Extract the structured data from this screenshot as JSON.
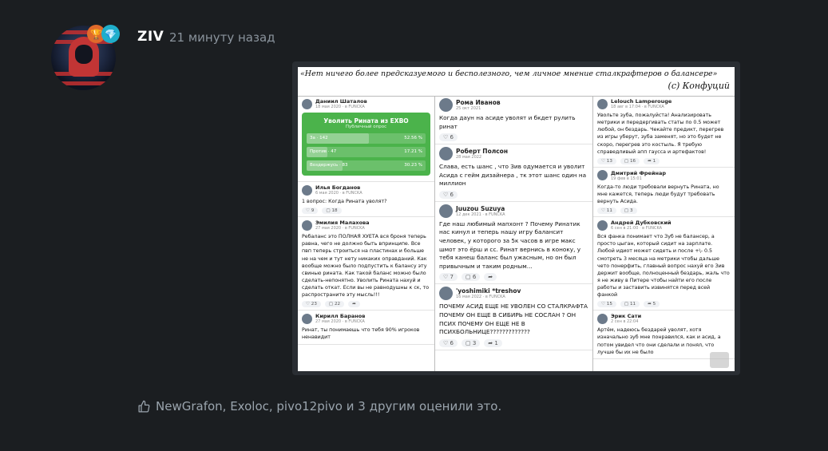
{
  "post": {
    "username": "ZIV",
    "timestamp": "21 минуту назад",
    "badges": [
      "trophy-icon",
      "gem-icon"
    ]
  },
  "image": {
    "quote_line": "«Нет ничего более предсказуемого и бесполезного, чем личное мнение сталкрафтеров о балансере»",
    "quote_author": "(с) Конфуций",
    "col1": {
      "post1": {
        "name": "Даниил Шаталов",
        "date": "18 мая 2020 · в FUNCKA"
      },
      "poll": {
        "title": "Уволить Рината из EXBO",
        "subtitle": "Публичный опрос",
        "options": [
          {
            "label": "За",
            "count": "142",
            "percent": "52.56 %",
            "share": 0.5256
          },
          {
            "label": "Против",
            "count": "47",
            "percent": "17.21 %",
            "share": 0.1721
          },
          {
            "label": "Воздержусь",
            "count": "83",
            "percent": "30.23 %",
            "share": 0.3023
          }
        ]
      },
      "post2": {
        "name": "Илья Богданов",
        "date": "6 мая 2020 · в FUNCKA",
        "text": "1 вопрос: Когда Рината уволят?",
        "likes": "9",
        "comments": "18"
      },
      "post3": {
        "name": "Эмилия Малахова",
        "date": "27 мая 2020 · в FUNCKA",
        "text": "Ребаланс это ПОЛНАЯ ХУЕТА вся броня теперь равна, чего не должно быть впринципе. Все пвп теперь строиться на пластинах и больше не на чем и тут нету никаких оправданий. Как вообще можно было подпустить к балансу эту свинью рината. Как такой баланс можно было сделать-непонятно. Уволить Рината нахуй и сделать откат. Если вы не равнодушны к ск, то распространите эту мысль!!!",
        "likes": "23",
        "comments": "22"
      },
      "post4": {
        "name": "Кирилл Баранов",
        "date": "27 мая 2020 · в FUNCKA",
        "text": "Ринат, ты понимаешь что тебя 90% игроков ненавидит"
      }
    },
    "col2": {
      "post1": {
        "name": "Рома Иванов",
        "date": "25 окт 2021",
        "text": "Когда даун на асиде уволят и бкдет рулить ринат",
        "likes": "6"
      },
      "post2": {
        "name": "Роберт Полсон",
        "date": "28 мая 2022",
        "text": "Слава, есть шанс , что Зив одумается и уволит Асида с гейм дизайнера , тк этот шанс один на миллион",
        "likes": "6"
      },
      "post3": {
        "name": "Juuzou Suzuya",
        "date": "12 дек 2021 · в FUNCKA",
        "text": "Где наш любимый мапхонт ? Почему Ринатик нас кинул и теперь нашу игру балансит человек, у которого за 5к часов в игре макс шмот это ёрш и сс. Ринат вернись в коноку, у тебя канеш баланс был ужасным, но он был привычным и таким родным...",
        "likes": "7",
        "comments": "6"
      },
      "post4": {
        "name": "'yoshimiki *treshov",
        "date": "16 мая 2022 · в FUNCKA",
        "text": "ПОЧЕМУ АСИД ЕЩЕ НЕ УВОЛЕН СО СТАЛКРАФТА ПОЧЕМУ ОН ЕЩЕ В СИБИРЬ НЕ СОСЛАН ? ОН ПСИХ ПОЧЕМУ ОН ЕЩЕ НЕ В ПСИХБОЛЬНИЦЕ?????????????",
        "likes": "6",
        "comments": "3",
        "shares": "1"
      }
    },
    "col3": {
      "post1": {
        "name": "Lelouch Lamperouge",
        "date": "18 авг в 17:04 · в FUNCKA",
        "text": "Увольте зуба, пожалуйста! Анализировать метрики и передергивать статы по 0.5 может любой, он бездарь. Чекайте предикт, перегрев из игры уберут, зуба заменят, но это будет не скоро, перегрев это костыль. Я требую справедливый апп гаусса и артефактов!",
        "likes": "13",
        "comments": "16",
        "shares": "1"
      },
      "post2": {
        "name": "Дмитрий Фрейнар",
        "date": "19 фев в 15:01",
        "text": "Когда-то люди требовали вернуть Рината, но мне кажется, теперь люди будут требовать вернуть Асида.",
        "likes": "11",
        "comments": "3"
      },
      "post3": {
        "name": "Андрей Дубковский",
        "date": "6 сен в 21:00 · в FUNCKA",
        "text": "Вся фанка понимает что Зуб не балансер, а просто цыган, который сидит на зарплате. Любой идиот может сидеть и после +\\- 0.5 смотреть 3 месяца на метрики чтобы дальше чето понерфить, главный вопрос нахуй его Зив держит вообще, полноценный бездарь, жаль что я не живу в Питере чтобы найти его после работы и заставить извинятся перед всей фанкой",
        "likes": "15",
        "comments": "11",
        "shares": "5"
      },
      "post4": {
        "name": "Эрик Сати",
        "date": "2 сен в 22:04",
        "text": "Артём, надеюсь бездарей уволят, хотя изначально зуб мне понравился, как и асид, а потом увидел что они сделали и понял, что лучше бы их не было"
      }
    }
  },
  "footer": {
    "likes_text": "NewGrafon, Exoloc, pivo12pivo и 3 другим оценили это."
  },
  "colors": {
    "background": "#1b1e21",
    "poll_green": "#4bb34b",
    "muted": "#9aa4ad"
  }
}
